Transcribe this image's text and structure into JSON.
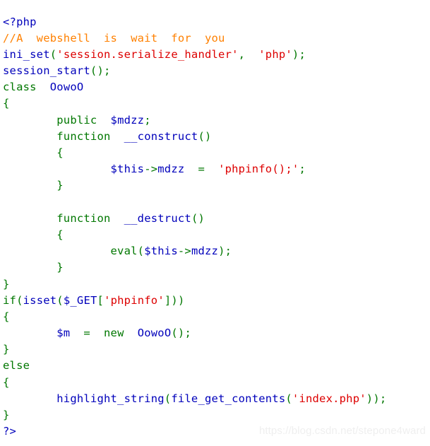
{
  "page": {
    "title": "PHP source highlighted output",
    "background_color": "#ffffff"
  },
  "palette": {
    "default": "#0000BB",
    "keyword": "#007700",
    "string": "#DD0000",
    "comment": "#FF8000",
    "variable": "#0000BB"
  },
  "code": {
    "language": "php",
    "lines": [
      "<?php",
      "//A  webshell  is  wait  for  you",
      "ini_set('session.serialize_handler',  'php');",
      "session_start();",
      "class  OowoO",
      "{",
      "        public  $mdzz;",
      "        function  __construct()",
      "        {",
      "                $this->mdzz  =  'phpinfo();';",
      "        }",
      "",
      "        function  __destruct()",
      "        {",
      "                eval($this->mdzz);",
      "        }",
      "}",
      "if(isset($_GET['phpinfo']))",
      "{",
      "        $m  =  new  OowoO();",
      "}",
      "else",
      "{",
      "        highlight_string(file_get_contents('index.php'));",
      "}",
      "?>"
    ],
    "plain_text": "<?php\n//A  webshell  is  wait  for  you\nini_set('session.serialize_handler',  'php');\nsession_start();\nclass  OowoO\n{\n        public  $mdzz;\n        function  __construct()\n        {\n                $this->mdzz  =  'phpinfo();';\n        }\n\n        function  __destruct()\n        {\n                eval($this->mdzz);\n        }\n}\nif(isset($_GET['phpinfo']))\n{\n        $m  =  new  OowoO();\n}\nelse\n{\n        highlight_string(file_get_contents('index.php'));\n}\n?>"
  },
  "tokens": {
    "l1_php_open": "<?php",
    "l2_comment": "//A  webshell  is  wait  for  you",
    "l3_fn": "ini_set",
    "l3_paren_open": "(",
    "l3_str1": "'session.serialize_handler'",
    "l3_comma": ",  ",
    "l3_str2": "'php'",
    "l3_paren_close": ");",
    "l4_fn": "session_start",
    "l4_paren": "();",
    "l5_kw": "class",
    "l5_space": "  ",
    "l5_name": "OowoO",
    "l6_brace": "{",
    "l7_indent": "        ",
    "l7_kw": "public",
    "l7_space": "  ",
    "l7_var": "$mdzz",
    "l7_semi": ";",
    "l8_indent": "        ",
    "l8_kw": "function",
    "l8_space": "  ",
    "l8_name": "__construct",
    "l8_paren": "()",
    "l9_indent": "        ",
    "l9_brace": "{",
    "l10_indent": "                ",
    "l10_var": "$this",
    "l10_arrow": "->",
    "l10_prop": "mdzz",
    "l10_eq": "  =  ",
    "l10_str": "'phpinfo();'",
    "l10_semi": ";",
    "l11_indent": "        ",
    "l11_brace": "}",
    "l13_indent": "        ",
    "l13_kw": "function",
    "l13_space": "  ",
    "l13_name": "__destruct",
    "l13_paren": "()",
    "l14_indent": "        ",
    "l14_brace": "{",
    "l15_indent": "                ",
    "l15_kw": "eval",
    "l15_paren_open": "(",
    "l15_var": "$this",
    "l15_arrow": "->",
    "l15_prop": "mdzz",
    "l15_paren_close": ");",
    "l16_indent": "        ",
    "l16_brace": "}",
    "l17_brace": "}",
    "l18_kw": "if",
    "l18_paren_open": "(",
    "l18_fn": "isset",
    "l18_paren2": "(",
    "l18_var": "$_GET",
    "l18_brk_open": "[",
    "l18_str": "'phpinfo'",
    "l18_brk_close": "]",
    "l18_paren_close": "))",
    "l19_brace": "{",
    "l20_indent": "        ",
    "l20_var": "$m",
    "l20_eq": "  =  ",
    "l20_new": "new",
    "l20_space": "  ",
    "l20_name": "OowoO",
    "l20_paren": "();",
    "l21_brace": "}",
    "l22_kw": "else",
    "l23_brace": "{",
    "l24_indent": "        ",
    "l24_fn1": "highlight_string",
    "l24_paren_open": "(",
    "l24_fn2": "file_get_contents",
    "l24_paren2": "(",
    "l24_str": "'index.php'",
    "l24_paren_close": "));",
    "l25_brace": "}",
    "l26_php_close": "?>"
  },
  "watermark": {
    "text": "https://blog.csdn.net/stepone4ward",
    "color": "#efefef"
  }
}
